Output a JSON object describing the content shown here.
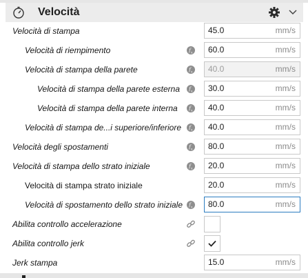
{
  "section": {
    "title": "Velocità",
    "icon": "stopwatch-icon"
  },
  "rows": [
    {
      "label": "Velocità di stampa",
      "value": "45.0",
      "unit": "mm/s"
    },
    {
      "label": "Velocità di riempimento",
      "value": "60.0",
      "unit": "mm/s"
    },
    {
      "label": "Velocità di stampa della parete",
      "value": "40.0",
      "unit": "mm/s"
    },
    {
      "label": "Velocità di stampa della parete esterna",
      "value": "30.0",
      "unit": "mm/s"
    },
    {
      "label": "Velocità di stampa della parete interna",
      "value": "40.0",
      "unit": "mm/s"
    },
    {
      "label": "Velocità di stampa de...i superiore/inferiore",
      "value": "40.0",
      "unit": "mm/s"
    },
    {
      "label": "Velocità degli spostamenti",
      "value": "80.0",
      "unit": "mm/s"
    },
    {
      "label": "Velocità di stampa dello strato iniziale",
      "value": "20.0",
      "unit": "mm/s"
    },
    {
      "label": "Velocità di stampa strato iniziale",
      "value": "20.0",
      "unit": "mm/s"
    },
    {
      "label": "Velocità di spostamento dello strato iniziale",
      "value": "80.0",
      "unit": "mm/s"
    },
    {
      "label": "Abilita controllo accelerazione",
      "checked": false
    },
    {
      "label": "Abilita controllo jerk",
      "checked": true
    },
    {
      "label": "Jerk stampa",
      "value": "15.0",
      "unit": "mm/s"
    }
  ],
  "colors": {
    "header_bg": "#ececec",
    "focus_border": "#2a7bc0",
    "fx_badge": "#8e8e8e"
  }
}
